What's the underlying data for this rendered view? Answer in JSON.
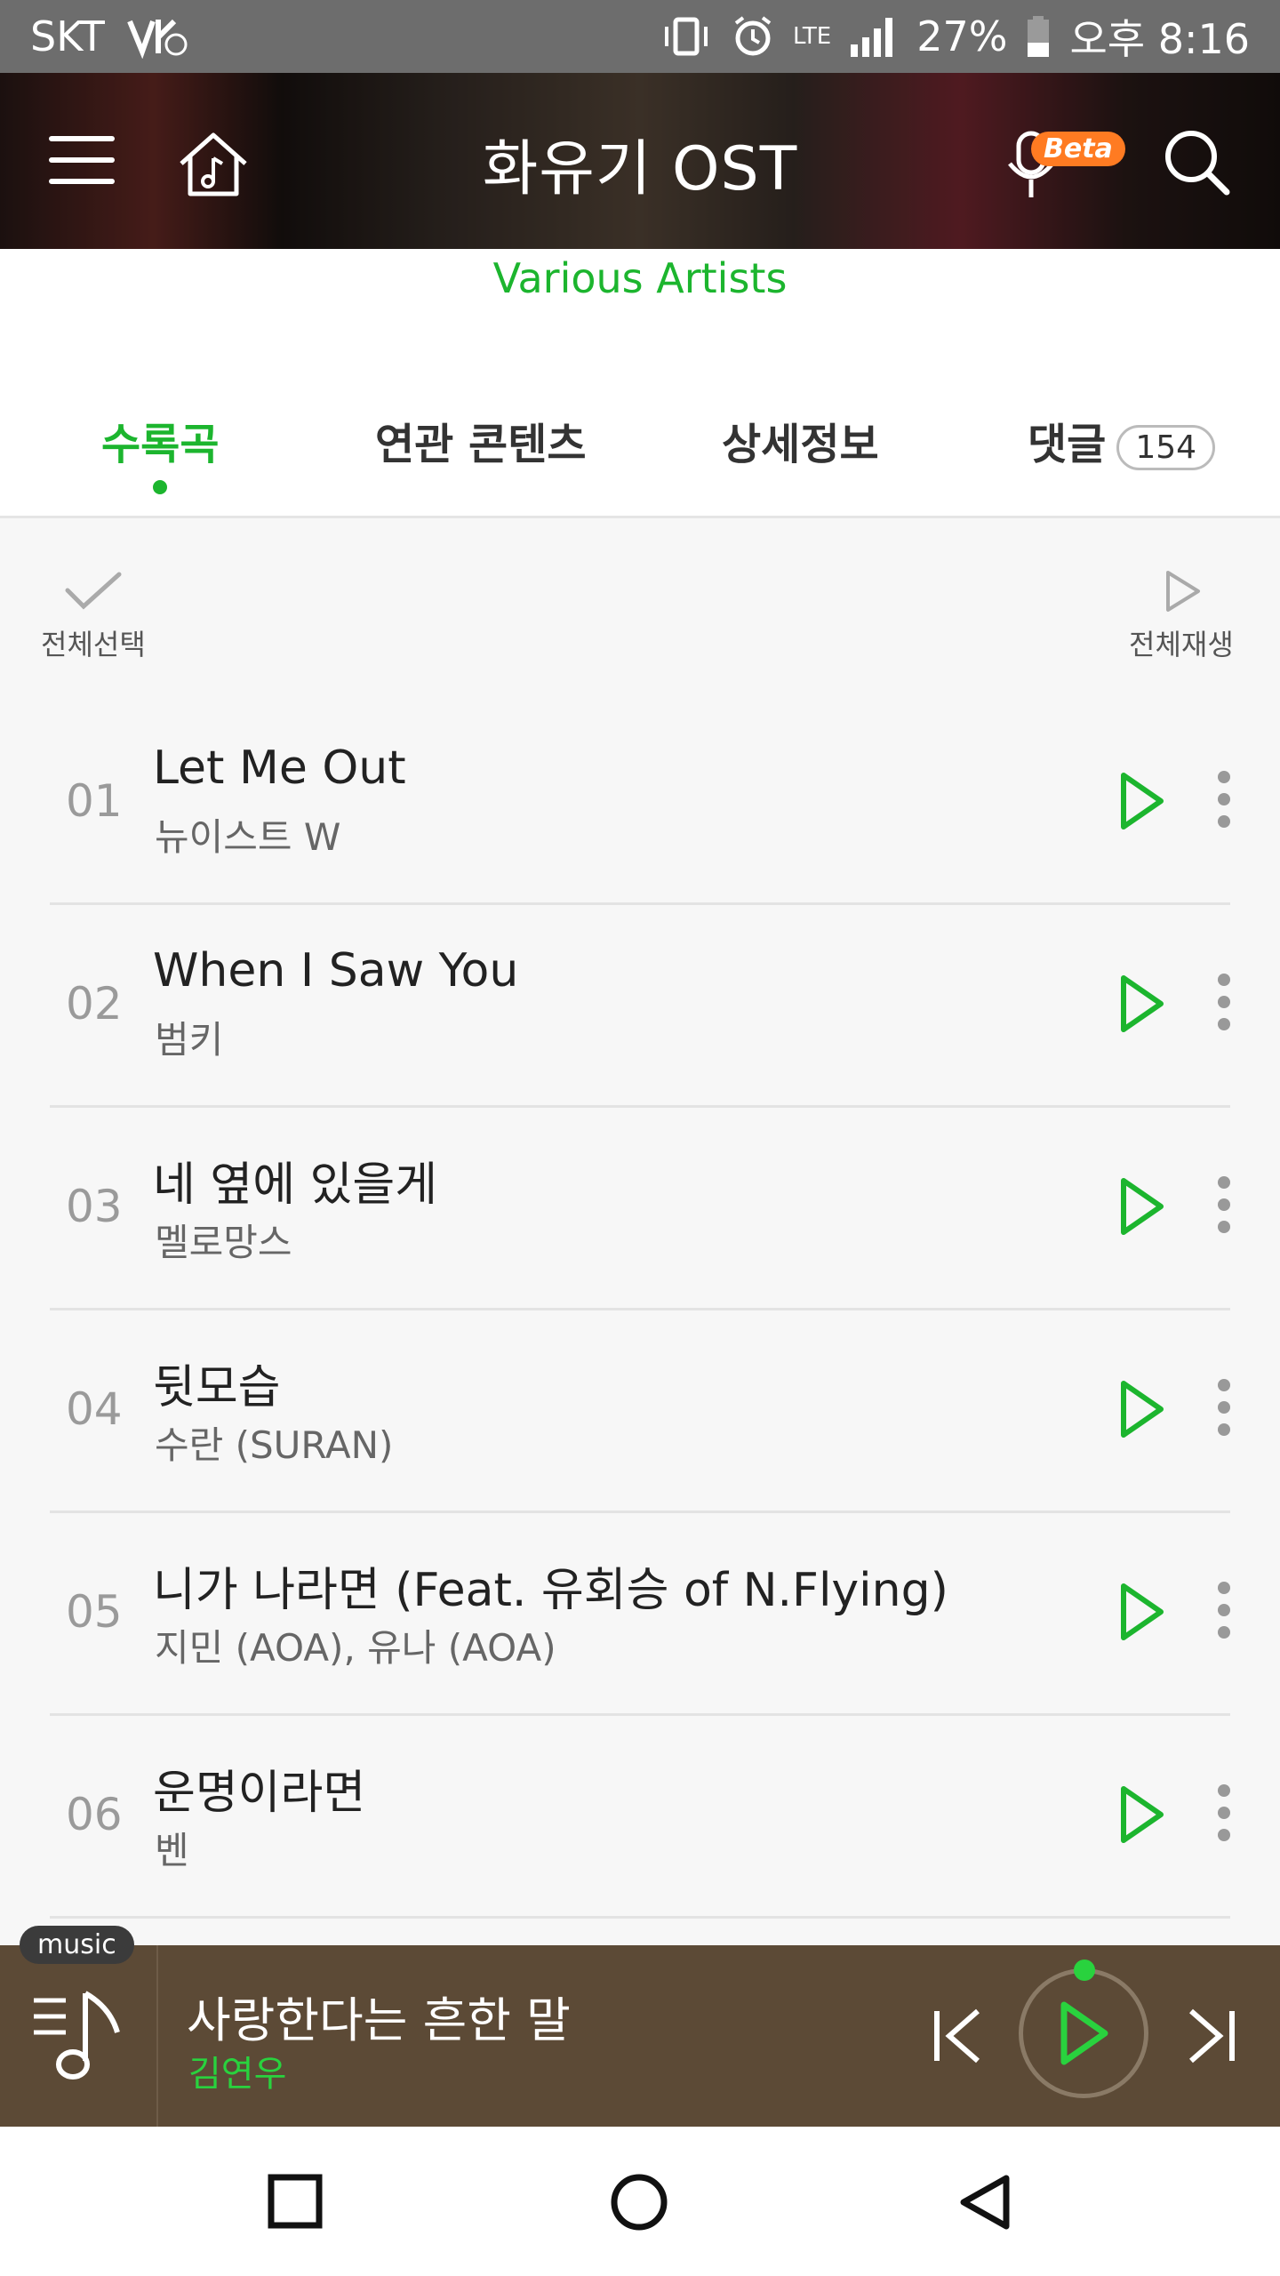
{
  "status_bar": {
    "carrier": "SKT",
    "network": "LTE",
    "battery": "27%",
    "time": "오후 8:16"
  },
  "header": {
    "title": "화유기 OST",
    "beta_badge": "Beta",
    "subtitle": "Various Artists"
  },
  "tabs": [
    {
      "label": "수록곡",
      "active": true
    },
    {
      "label": "연관 콘텐츠",
      "active": false
    },
    {
      "label": "상세정보",
      "active": false
    },
    {
      "label": "댓글",
      "count": "154",
      "active": false
    }
  ],
  "controls": {
    "select_all": "전체선택",
    "play_all": "전체재생"
  },
  "tracks": [
    {
      "num": "01",
      "title": "Let Me Out",
      "artist": "뉴이스트 W"
    },
    {
      "num": "02",
      "title": "When I Saw You",
      "artist": "범키"
    },
    {
      "num": "03",
      "title": "네 옆에 있을게",
      "artist": "멜로망스"
    },
    {
      "num": "04",
      "title": "뒷모습",
      "artist": "수란 (SURAN)"
    },
    {
      "num": "05",
      "title": "니가 나라면 (Feat. 유회승 of N.Flying)",
      "artist": "지민 (AOA), 유나 (AOA)"
    },
    {
      "num": "06",
      "title": "운명이라면",
      "artist": "벤"
    }
  ],
  "player": {
    "tag": "music",
    "title": "사랑한다는 흔한 말",
    "artist": "김연우"
  },
  "colors": {
    "accent": "#1cb52e",
    "player_bg": "#5c4a36",
    "beta": "#ff7b22"
  }
}
